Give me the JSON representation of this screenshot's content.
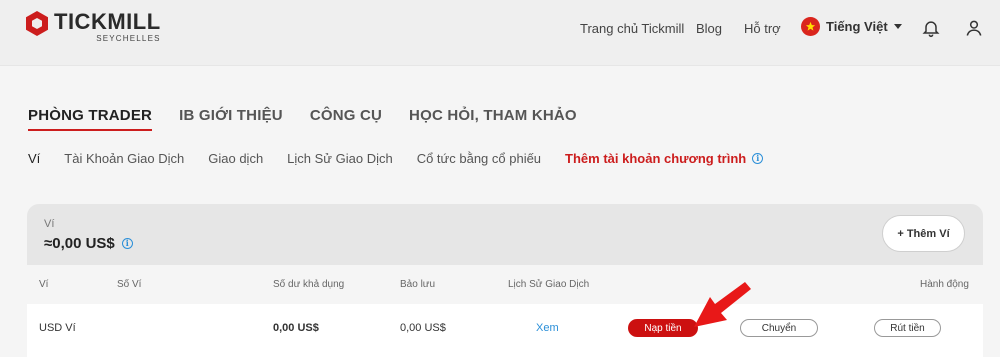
{
  "brand": {
    "name": "TICKMILL",
    "sub": "SEYCHELLES",
    "color": "#cc1d1d"
  },
  "topnav": {
    "links": [
      "Trang chủ Tickmill",
      "Blog",
      "Hỗ trợ"
    ],
    "language": "Tiếng Việt",
    "bell_icon": "bell-icon",
    "user_icon": "user-icon"
  },
  "main_tabs": [
    "PHÒNG TRADER",
    "IB GIỚI THIỆU",
    "CÔNG CỤ",
    "HỌC HỎI, THAM KHẢO"
  ],
  "sub_tabs": [
    "Ví",
    "Tài Khoản Giao Dịch",
    "Giao dịch",
    "Lịch Sử Giao Dịch",
    "Cổ tức bằng cổ phiếu",
    "Thêm tài khoản chương trình"
  ],
  "wallet": {
    "label": "Ví",
    "balance": "≈0,00 US$",
    "add_button": "+ Thêm Ví"
  },
  "table": {
    "headers": [
      "Ví",
      "Số Ví",
      "Số dư khả dụng",
      "Bảo lưu",
      "Lịch Sử Giao Dịch",
      "Hành động"
    ],
    "rows": [
      {
        "wallet": "USD Ví",
        "number": "",
        "available": "0,00 US$",
        "reserved": "0,00 US$",
        "history_link": "Xem",
        "deposit": "Nạp tiền",
        "transfer": "Chuyển",
        "withdraw": "Rút tiền"
      }
    ]
  }
}
